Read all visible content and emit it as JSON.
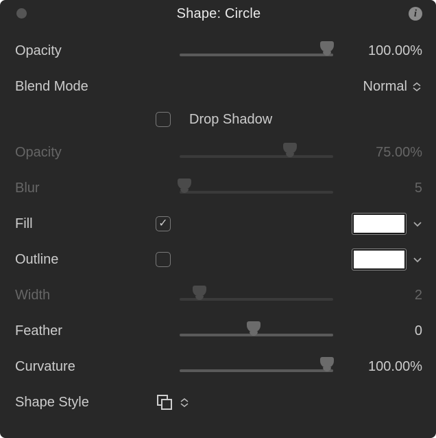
{
  "panel_title": "Shape: Circle",
  "rows": {
    "opacity": {
      "label": "Opacity",
      "value": "100.00%"
    },
    "blend": {
      "label": "Blend Mode",
      "value": "Normal"
    },
    "drop": {
      "label": "Drop Shadow"
    },
    "dsOpacity": {
      "label": "Opacity",
      "value": "75.00%"
    },
    "dsBlur": {
      "label": "Blur",
      "value": "5"
    },
    "fill": {
      "label": "Fill",
      "swatch": "#ffffff",
      "checked": true
    },
    "outline": {
      "label": "Outline",
      "swatch": "#ffffff",
      "checked": false
    },
    "width": {
      "label": "Width",
      "value": "2"
    },
    "feather": {
      "label": "Feather",
      "value": "0"
    },
    "curvature": {
      "label": "Curvature",
      "value": "100.00%"
    },
    "style": {
      "label": "Shape Style"
    }
  },
  "slider_positions": {
    "opacity": 96,
    "dsOpacity": 72,
    "dsBlur": 3,
    "width": 13,
    "feather": 48,
    "curvature": 96
  }
}
